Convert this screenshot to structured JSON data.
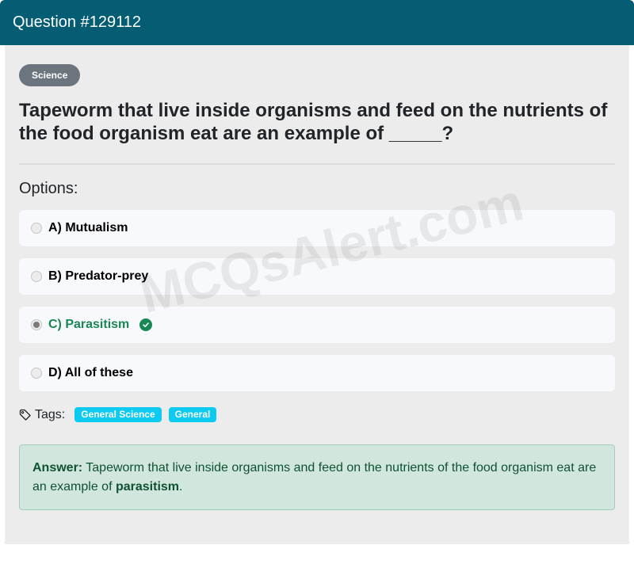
{
  "header": {
    "title": "Question #129112"
  },
  "category": "Science",
  "question": "Tapeworm that live inside organisms and feed on the nutrients of the food organism eat are an example of _____?",
  "options_label": "Options:",
  "options": [
    {
      "label": "A) Mutualism",
      "selected": false,
      "correct": false
    },
    {
      "label": "B) Predator-prey",
      "selected": false,
      "correct": false
    },
    {
      "label": "C) Parasitism",
      "selected": true,
      "correct": true
    },
    {
      "label": "D) All of these",
      "selected": false,
      "correct": false
    }
  ],
  "tags": {
    "label": "Tags:",
    "items": [
      "General Science",
      "General"
    ]
  },
  "answer": {
    "prefix": "Answer:",
    "text": "Tapeworm that live inside organisms and feed on the nutrients of the food organism eat are an example of",
    "highlight": "parasitism",
    "suffix": "."
  },
  "watermark": "MCQsAlert.com",
  "colors": {
    "header_bg": "#045d73",
    "correct": "#198754",
    "tag_bg": "#0dcaf0",
    "answer_bg": "#d1e7dd"
  },
  "icons": {
    "tag": "tag-icon",
    "check": "check-circle-icon"
  }
}
